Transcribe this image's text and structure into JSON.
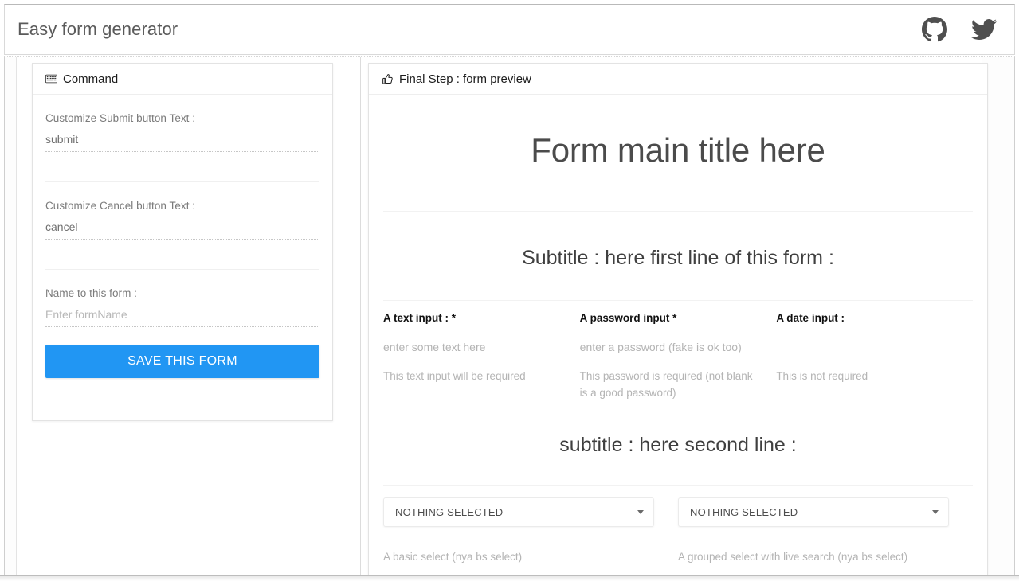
{
  "navbar": {
    "brand": "Easy form generator",
    "icons": [
      {
        "name": "github-icon",
        "label": "GitHub"
      },
      {
        "name": "twitter-icon",
        "label": "Twitter"
      }
    ]
  },
  "command_panel": {
    "header": "Command",
    "header_icon": "keyboard-icon",
    "fields": [
      {
        "label": "Customize Submit button Text :",
        "value": "submit",
        "placeholder": ""
      },
      {
        "label": "Customize Cancel button Text :",
        "value": "cancel",
        "placeholder": ""
      },
      {
        "label": "Name to this form :",
        "value": "",
        "placeholder": "Enter formName"
      }
    ],
    "save_button": "SAVE THIS FORM"
  },
  "preview_panel": {
    "header": "Final Step : form preview",
    "header_icon": "thumbs-up-icon",
    "form_title": "Form main title here",
    "subtitle_one": "Subtitle : here first line of this form :",
    "subtitle_two": "subtitle : here second line :",
    "inputs": [
      {
        "label": "A text input : *",
        "value": "",
        "placeholder": "enter some text here",
        "help": "This text input will be required"
      },
      {
        "label": "A password input *",
        "value": "",
        "placeholder": "enter a password (fake is ok too)",
        "help": "This password is required (not blank is a good password)"
      },
      {
        "label": "A date input :",
        "value": "",
        "placeholder": "",
        "help": "This is not required"
      }
    ],
    "selects": [
      {
        "value": "NOTHING SELECTED",
        "help": "A basic select (nya bs select)"
      },
      {
        "value": "NOTHING SELECTED",
        "help": "A grouped select with live search (nya bs select)"
      }
    ]
  },
  "colors": {
    "accent": "#2196f3",
    "brand_text": "#5a5a5a",
    "label_text": "#7b7b7b",
    "muted_text": "#b4b4b4"
  }
}
